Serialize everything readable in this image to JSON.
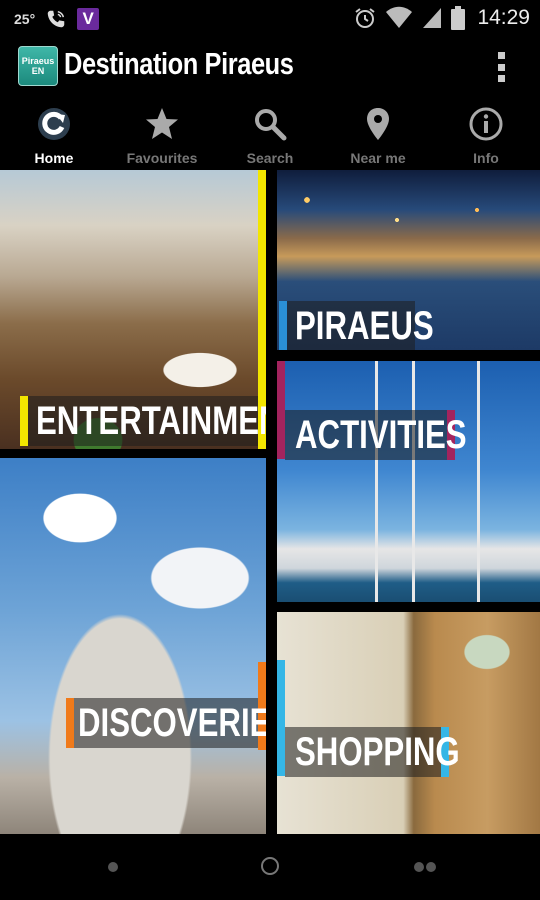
{
  "status_bar": {
    "temperature": "25°",
    "carrier_badge": "V",
    "time": "14:29",
    "icons": [
      "phone-icon",
      "v-app-icon",
      "alarm-clock-icon",
      "wifi-icon",
      "signal-icon",
      "battery-icon"
    ]
  },
  "app": {
    "logo_line1": "Piraeus",
    "logo_line2": "EN",
    "title": "Destination Piraeus"
  },
  "tabs": [
    {
      "label": "Home",
      "icon": "refresh-icon",
      "active": true
    },
    {
      "label": "Favourites",
      "icon": "star-icon",
      "active": false
    },
    {
      "label": "Search",
      "icon": "search-icon",
      "active": false
    },
    {
      "label": "Near me",
      "icon": "location-pin-icon",
      "active": false
    },
    {
      "label": "Info",
      "icon": "info-icon",
      "active": false
    }
  ],
  "tiles": {
    "entertainment": {
      "label": "ENTERTAINMENT",
      "accent": "#f3e600"
    },
    "piraeus": {
      "label": "PIRAEUS",
      "accent": "#2a8fd6"
    },
    "activities": {
      "label": "ACTIVITIES",
      "accent": "#a3245e"
    },
    "discoveries": {
      "label": "DISCOVERIES",
      "accent": "#f07a1a"
    },
    "shopping": {
      "label": "SHOPPING",
      "accent": "#35b6e6"
    }
  }
}
